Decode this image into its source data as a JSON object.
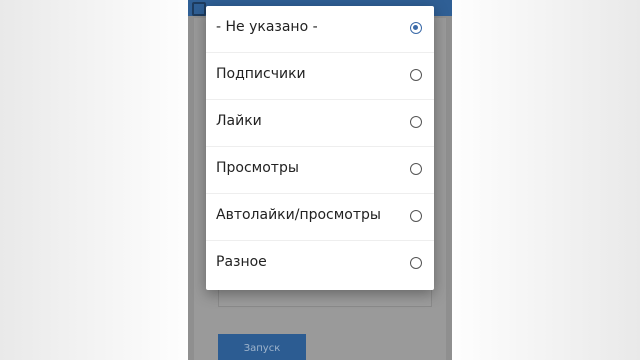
{
  "dialog": {
    "options": [
      {
        "label": "- Не указано -",
        "selected": true
      },
      {
        "label": "Подписчики",
        "selected": false
      },
      {
        "label": "Лайки",
        "selected": false
      },
      {
        "label": "Просмотры",
        "selected": false
      },
      {
        "label": "Автолайки/просмотры",
        "selected": false
      },
      {
        "label": "Разное",
        "selected": false
      }
    ]
  },
  "background_screen": {
    "run_button_label": "Запуск"
  },
  "colors": {
    "accent": "#3b6aa8",
    "topbar": "#2f5f95",
    "button": "#2c5c92"
  }
}
